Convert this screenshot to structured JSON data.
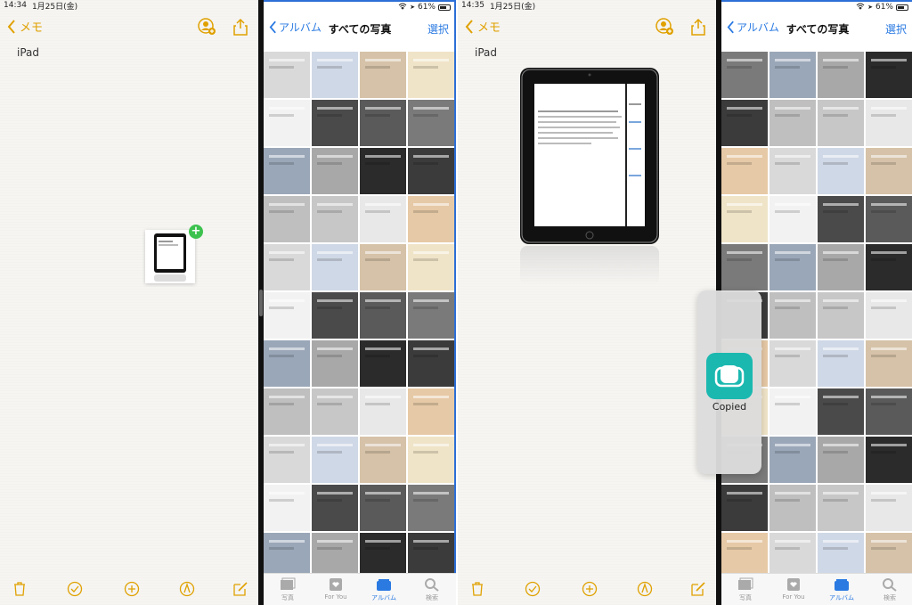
{
  "screens": [
    {
      "status_time": "14:34",
      "status_date": "1月25日(金)",
      "status_battery": "61%",
      "notes_back": "メモ",
      "note_text": "iPad",
      "photos_back": "アルバム",
      "photos_title": "すべての写真",
      "photos_select": "選択",
      "tabs": [
        "写真",
        "For You",
        "アルバム",
        "検索"
      ]
    },
    {
      "status_time": "14:35",
      "status_date": "1月25日(金)",
      "status_battery": "61%",
      "notes_back": "メモ",
      "note_text": "iPad",
      "photos_back": "アルバム",
      "photos_title": "すべての写真",
      "photos_select": "選択",
      "tabs": [
        "写真",
        "For You",
        "アルバム",
        "検索"
      ],
      "hud_label": "Copied"
    }
  ],
  "colors": {
    "notes_accent": "#e0a100",
    "ios_blue": "#2a7ae2",
    "hud_icon": "#1bb8b0",
    "add_badge": "#3ec24f"
  },
  "icons": {
    "notes_nav": [
      "person-add-icon",
      "share-icon"
    ],
    "notes_toolbar": [
      "trash-icon",
      "checklist-icon",
      "plus-icon",
      "pen-icon",
      "compose-icon"
    ],
    "tabs": [
      "photos-tab-icon",
      "for-you-tab-icon",
      "albums-tab-icon",
      "search-tab-icon"
    ]
  }
}
